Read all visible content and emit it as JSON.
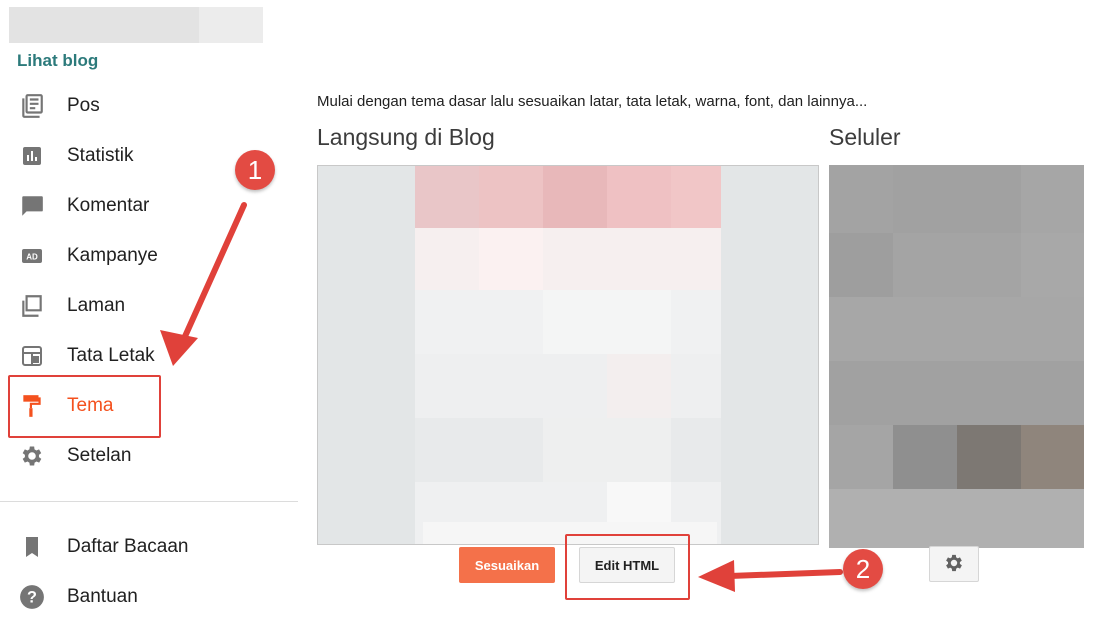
{
  "sidebar": {
    "view_blog": "Lihat blog",
    "items": [
      {
        "label": "Pos",
        "icon": "posts-icon"
      },
      {
        "label": "Statistik",
        "icon": "stats-icon"
      },
      {
        "label": "Komentar",
        "icon": "comment-icon"
      },
      {
        "label": "Kampanye",
        "icon": "ad-icon"
      },
      {
        "label": "Laman",
        "icon": "pages-icon"
      },
      {
        "label": "Tata Letak",
        "icon": "layout-icon"
      },
      {
        "label": "Tema",
        "icon": "paint-roller-icon",
        "active": true
      },
      {
        "label": "Setelan",
        "icon": "gear-icon"
      }
    ],
    "secondary_items": [
      {
        "label": "Daftar Bacaan",
        "icon": "bookmark-icon"
      },
      {
        "label": "Bantuan",
        "icon": "help-icon"
      }
    ]
  },
  "main": {
    "intro": "Mulai dengan tema dasar lalu sesuaikan latar, tata letak, warna, font, dan lainnya...",
    "live_title": "Langsung di Blog",
    "mobile_title": "Seluler",
    "customize_button": "Sesuaikan",
    "edit_html_button": "Edit HTML"
  },
  "annotations": {
    "step1": "1",
    "step2": "2",
    "color": "#e0413a"
  },
  "colors": {
    "accent": "#f4511e",
    "link": "#2c7a7b",
    "icon": "#757575"
  }
}
